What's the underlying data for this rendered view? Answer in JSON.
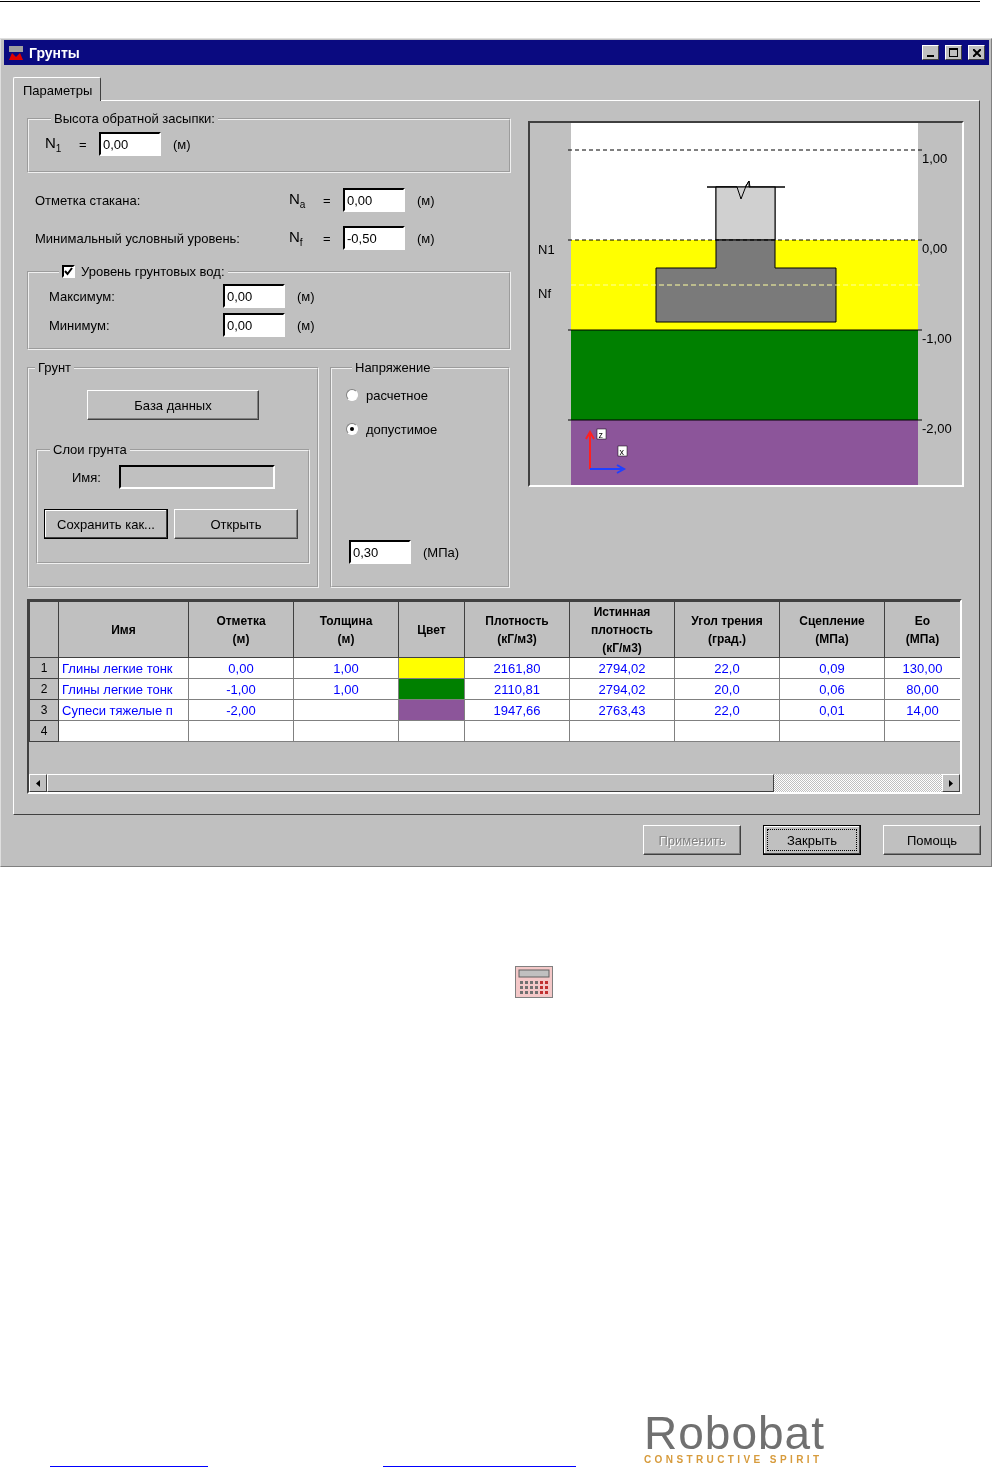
{
  "window": {
    "title": "Грунты"
  },
  "tabs": [
    {
      "label": "Параметры",
      "selected": true
    }
  ],
  "backfill": {
    "legend": "Высота обратной засыпки:",
    "symbol": "N$_{1}$",
    "eq": "=",
    "value": "0,00",
    "unit": "(м)"
  },
  "levels": [
    {
      "label": "Отметка стакана:",
      "symbol": "N$_{a}$",
      "eq": "=",
      "value": "0,00",
      "unit": "(м)"
    },
    {
      "label": "Минимальный условный уровень:",
      "symbol": "N$_{f}$",
      "eq": "=",
      "value": "-0,50",
      "unit": "(м)"
    }
  ],
  "groundwater": {
    "label": "Уровень грунтовых вод:",
    "checked": true,
    "rows": [
      {
        "label": "Максимум:",
        "value": "0,00",
        "unit": "(м)"
      },
      {
        "label": "Минимум:",
        "value": "0,00",
        "unit": "(м)"
      }
    ]
  },
  "soil": {
    "legend": "Грунт",
    "database_button": "База данных",
    "layers": {
      "legend": "Слои грунта",
      "name_label": "Имя:",
      "buttons": [
        "Сохранить как...",
        "Открыть"
      ]
    }
  },
  "stress": {
    "legend": "Напряжение",
    "options": [
      {
        "label": "расчетное",
        "selected": false
      },
      {
        "label": "допустимое",
        "selected": true
      }
    ],
    "value": "0,30",
    "unit": "(МПа)"
  },
  "diagram": {
    "left_labels": [
      "N1",
      "Nf"
    ],
    "right_labels": [
      "1,00",
      "0,00",
      "-1,00",
      "-2,00"
    ],
    "axis_labels": [
      "z",
      "x"
    ]
  },
  "table": {
    "columns": [
      "Имя",
      "Отметка\n(м)",
      "Толщина\n(м)",
      "Цвет",
      "Плотность\n(кГ/м3)",
      "Истинная\nплотность\n(кГ/м3)",
      "Угол трения\n(град.)",
      "Сцепление\n(МПа)",
      "Ео\n(МПа)"
    ],
    "rows": [
      {
        "number": "1",
        "name": "Глины легкие тонк",
        "mark": "0,00",
        "thickness": "1,00",
        "color": "#ffff00",
        "density": "2161,80",
        "true_density": "2794,02",
        "friction": "22,0",
        "cohesion": "0,09",
        "eo": "130,00"
      },
      {
        "number": "2",
        "name": "Глины легкие тонк",
        "mark": "-1,00",
        "thickness": "1,00",
        "color": "#008000",
        "density": "2110,81",
        "true_density": "2794,02",
        "friction": "20,0",
        "cohesion": "0,06",
        "eo": "80,00"
      },
      {
        "number": "3",
        "name": "Супеси тяжелые п",
        "mark": "-2,00",
        "color": "#8c559a",
        "density": "1947,66",
        "true_density": "2763,43",
        "friction": "22,0",
        "cohesion": "0,01",
        "eo": "14,00"
      },
      {
        "number": "4"
      }
    ]
  },
  "buttons": [
    {
      "label": "Применить",
      "disabled": true,
      "focused": false
    },
    {
      "label": "Закрыть",
      "disabled": false,
      "focused": true
    },
    {
      "label": "Помощь",
      "disabled": false,
      "focused": false
    }
  ],
  "logo": {
    "name": "Robobat",
    "tagline": "CONSTRUCTIVE SPIRIT"
  }
}
